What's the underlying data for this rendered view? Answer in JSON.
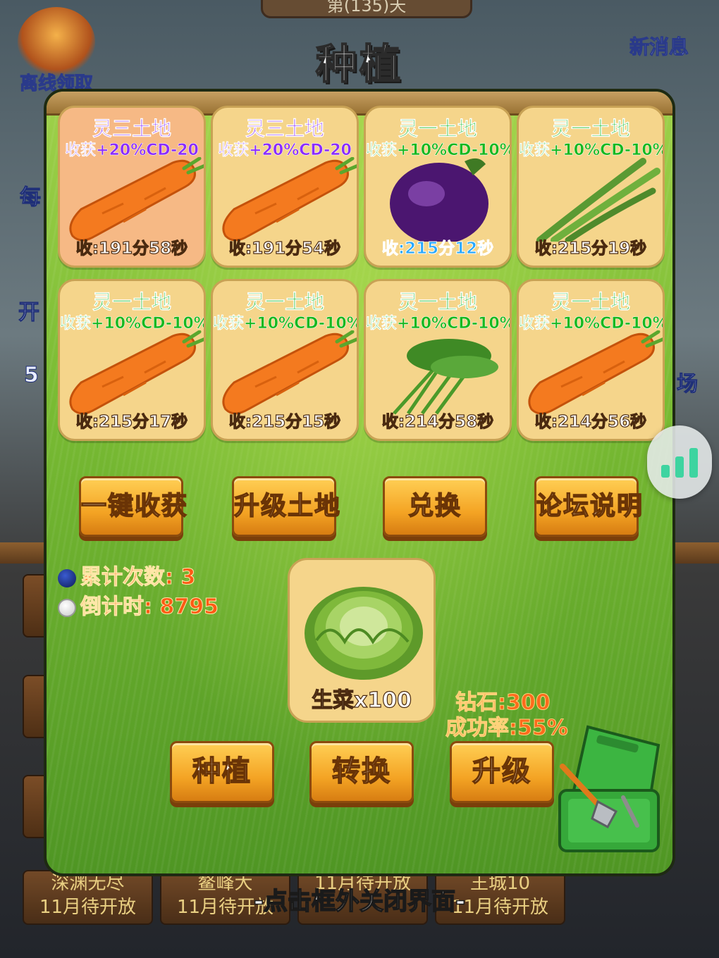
{
  "background": {
    "top_banner": "第(135)天",
    "left_icon_label": "离线领取",
    "right_icon_label": "新消息",
    "side_fragments": [
      "每",
      "开",
      "5",
      "场"
    ],
    "bottom_tiles": [
      {
        "name": "深渊无尽",
        "status": "11月待开放"
      },
      {
        "name": "鳌峰大",
        "status": "11月待开放"
      },
      {
        "name": "",
        "status": "11月待开放"
      },
      {
        "name": "王城10",
        "status": "11月待开放"
      }
    ]
  },
  "panel": {
    "title": "种植",
    "plots": [
      {
        "name": "灵三土地",
        "bonus": "收获+20%CD-20",
        "timer": "收:191分58秒",
        "crop": "carrot-icon",
        "tier": "tier3",
        "highlight": true,
        "timer_style": "normal"
      },
      {
        "name": "灵三土地",
        "bonus": "收获+20%CD-20",
        "timer": "收:191分54秒",
        "crop": "carrot-icon",
        "tier": "tier3",
        "highlight": false,
        "timer_style": "normal"
      },
      {
        "name": "灵一土地",
        "bonus": "收获+10%CD-10%",
        "timer": "收:215分12秒",
        "crop": "eggplant-icon",
        "tier": "tier1",
        "highlight": false,
        "timer_style": "blue"
      },
      {
        "name": "灵一土地",
        "bonus": "收获+10%CD-10%",
        "timer": "收:215分19秒",
        "crop": "green-bean-icon",
        "tier": "tier1",
        "highlight": false,
        "timer_style": "normal"
      },
      {
        "name": "灵一土地",
        "bonus": "收获+10%CD-10%",
        "timer": "收:215分17秒",
        "crop": "carrot-icon",
        "tier": "tier1",
        "highlight": false,
        "timer_style": "normal"
      },
      {
        "name": "灵一土地",
        "bonus": "收获+10%CD-10%",
        "timer": "收:215分15秒",
        "crop": "carrot-icon",
        "tier": "tier1",
        "highlight": false,
        "timer_style": "normal"
      },
      {
        "name": "灵一土地",
        "bonus": "收获+10%CD-10%",
        "timer": "收:214分58秒",
        "crop": "water-spinach-icon",
        "tier": "tier1",
        "highlight": false,
        "timer_style": "normal"
      },
      {
        "name": "灵一土地",
        "bonus": "收获+10%CD-10%",
        "timer": "收:214分56秒",
        "crop": "carrot-icon",
        "tier": "tier1",
        "highlight": false,
        "timer_style": "normal"
      }
    ],
    "actions": [
      "一键收获",
      "升级土地",
      "兑换",
      "论坛说明"
    ],
    "stats": {
      "total_label": "累计次数:",
      "total_value": "3",
      "countdown_label": "倒计时:",
      "countdown_value": "8795"
    },
    "seed": {
      "label": "生菜x100",
      "icon": "lettuce-icon"
    },
    "upgrade": {
      "cost": "钻石:300",
      "success_rate": "成功率:55%"
    },
    "bottom_buttons": [
      "种植",
      "转换",
      "升级"
    ],
    "toolbox_icon": "toolbox-icon"
  },
  "footer_hint": "-点击框外关闭界面-",
  "floating_button_icon": "signal-bars-icon"
}
